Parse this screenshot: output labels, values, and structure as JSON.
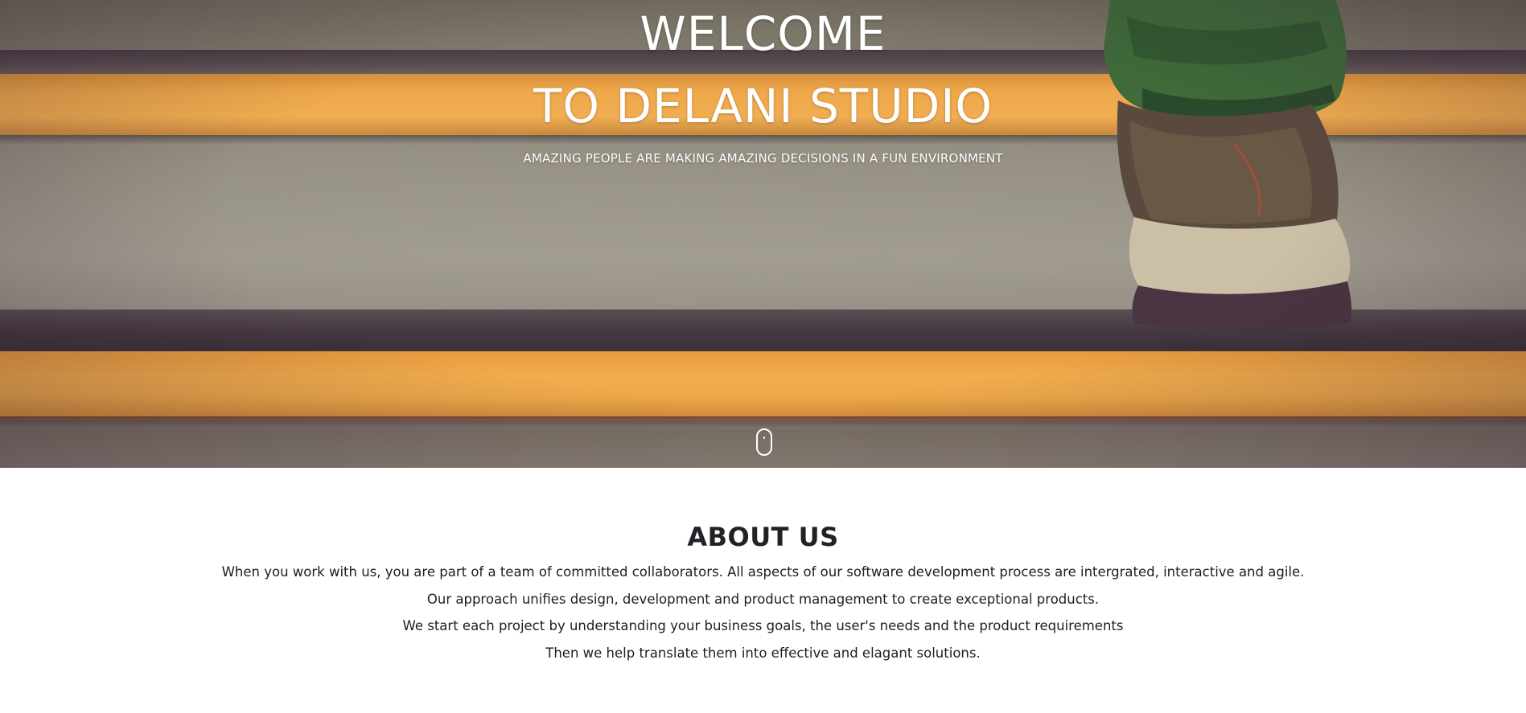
{
  "hero": {
    "title_line1": "WELCOME",
    "title_line2": "TO DELANI STUDIO",
    "tagline": "AMAZING PEOPLE ARE MAKING AMAZING DECISIONS IN A FUN ENVIRONMENT",
    "scroll_icon": "mouse-scroll-icon"
  },
  "about": {
    "title": "ABOUT US",
    "lines": [
      "When you work with us, you are part of a team of committed collaborators. All aspects of our software development process are intergrated, interactive and agile.",
      "Our approach unifies design, development and product management to create exceptional products.",
      "We start each project by understanding your business goals, the user's needs and the product requirements",
      "Then we help translate them into effective and elagant solutions."
    ]
  },
  "colors": {
    "stripe": "#f0ad52",
    "text_light": "#ffffff",
    "text_dark": "#1f1f24"
  }
}
